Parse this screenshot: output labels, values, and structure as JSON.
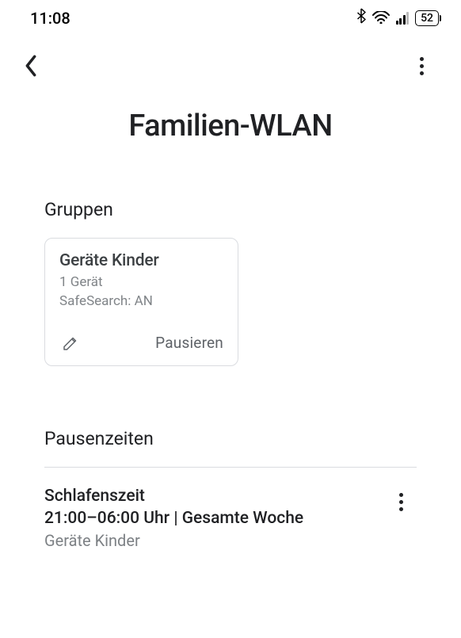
{
  "status_bar": {
    "time": "11:08",
    "battery": "52"
  },
  "page": {
    "title": "Familien-WLAN"
  },
  "groups": {
    "header": "Gruppen",
    "cards": [
      {
        "title": "Geräte Kinder",
        "device_count": "1 Gerät",
        "safesearch": "SafeSearch: AN",
        "pause_label": "Pausieren"
      }
    ]
  },
  "pause_times": {
    "header": "Pausenzeiten",
    "items": [
      {
        "name": "Schlafenszeit",
        "schedule": "21:00–06:00 Uhr | Gesamte Woche",
        "group": "Geräte Kinder"
      }
    ]
  }
}
